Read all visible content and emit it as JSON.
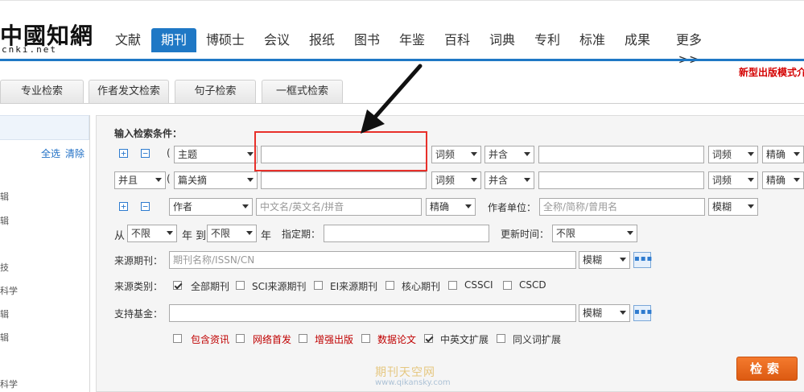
{
  "brand": {
    "logo_cn": "中國知網",
    "logo_en": "cnki.net"
  },
  "nav": {
    "items": [
      "文献",
      "期刊",
      "博硕士",
      "会议",
      "报纸",
      "图书",
      "年鉴",
      "百科",
      "词典",
      "专利",
      "标准",
      "成果",
      "更多>>"
    ],
    "active": "期刊"
  },
  "promo": "新型出版模式介",
  "tabs": [
    "专业检索",
    "作者发文检索",
    "句子检索",
    "一框式检索"
  ],
  "sidebar": {
    "select_all": "全选",
    "clear": "清除",
    "fragments": [
      "辑",
      "辑",
      "技",
      "科学",
      "辑",
      "辑",
      "科学"
    ]
  },
  "form": {
    "title": "输入检索条件：",
    "row1": {
      "paren": "(",
      "field": "主题",
      "value": "",
      "freq1": "词频",
      "join": "并含",
      "value2": "",
      "freq2": "词频",
      "match": "精确"
    },
    "row2": {
      "logic": "并且",
      "paren": "(",
      "field": "篇关摘",
      "value": "",
      "freq1": "词频",
      "join": "并含",
      "value2": "",
      "freq2": "词频",
      "match": "精确"
    },
    "author": {
      "field": "作者",
      "placeholder": "中文名/英文名/拼音",
      "match": "精确",
      "unit_label": "作者单位：",
      "unit_placeholder": "全称/简称/曾用名",
      "unit_match": "模糊"
    },
    "date": {
      "from_label": "从",
      "from": "不限",
      "year_to": "年 到",
      "to": "不限",
      "year": "年",
      "period_label": "指定期：",
      "update_label": "更新时间：",
      "update": "不限"
    },
    "source": {
      "label": "来源期刊：",
      "placeholder": "期刊名称/ISSN/CN",
      "match": "模糊",
      "more": "▪▪▪"
    },
    "category": {
      "label": "来源类别：",
      "options": [
        {
          "label": "全部期刊",
          "checked": true
        },
        {
          "label": "SCI来源期刊",
          "checked": false
        },
        {
          "label": "EI来源期刊",
          "checked": false
        },
        {
          "label": "核心期刊",
          "checked": false
        },
        {
          "label": "CSSCI",
          "checked": false
        },
        {
          "label": "CSCD",
          "checked": false
        }
      ]
    },
    "fund": {
      "label": "支持基金：",
      "match": "模糊",
      "more": "▪▪▪"
    },
    "extras": [
      {
        "label": "包含资讯",
        "checked": false,
        "color": "#c00000"
      },
      {
        "label": "网络首发",
        "checked": false,
        "color": "#c00000"
      },
      {
        "label": "增强出版",
        "checked": false,
        "color": "#c00000"
      },
      {
        "label": "数据论文",
        "checked": false,
        "color": "#c00000"
      },
      {
        "label": "中英文扩展",
        "checked": true,
        "color": "#333333"
      },
      {
        "label": "同义词扩展",
        "checked": false,
        "color": "#333333"
      }
    ],
    "search_button": "检索"
  },
  "watermark": {
    "cn": "期刊天空网",
    "url": "www.qikansky.com"
  },
  "colors": {
    "accent": "#1f78c5",
    "button": "#e8661f",
    "highlight": "#e8302a",
    "red_text": "#c00000"
  }
}
